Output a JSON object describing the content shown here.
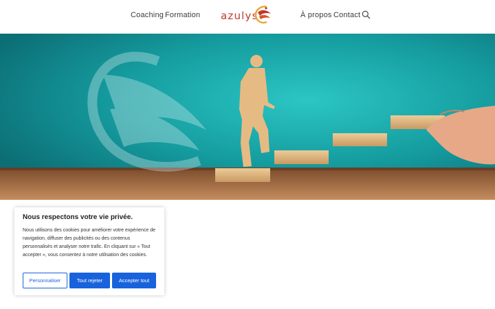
{
  "nav": {
    "coaching": "Coaching",
    "formation": "Formation",
    "logo_text": "azulys",
    "apropos": "À propos",
    "contact": "Contact"
  },
  "icons": {
    "search": "search-icon",
    "logo_mark": "phoenix-logo-icon"
  },
  "colors": {
    "brand": "#c0392b",
    "accent_blue": "#1863dc",
    "hero_teal": "#1b9fa0"
  },
  "cookie": {
    "title": "Nous respectons votre vie privée.",
    "body": "Nous utilisons des cookies pour améliorer votre expérience de navigation, diffuser des publicités ou des contenus personnalisés et analyser notre trafic. En cliquant sur « Tout accepter », vous consentez à notre utilisation des cookies.",
    "customize": "Personnaliser",
    "reject": "Tout rejeter",
    "accept": "Accepter tout"
  }
}
